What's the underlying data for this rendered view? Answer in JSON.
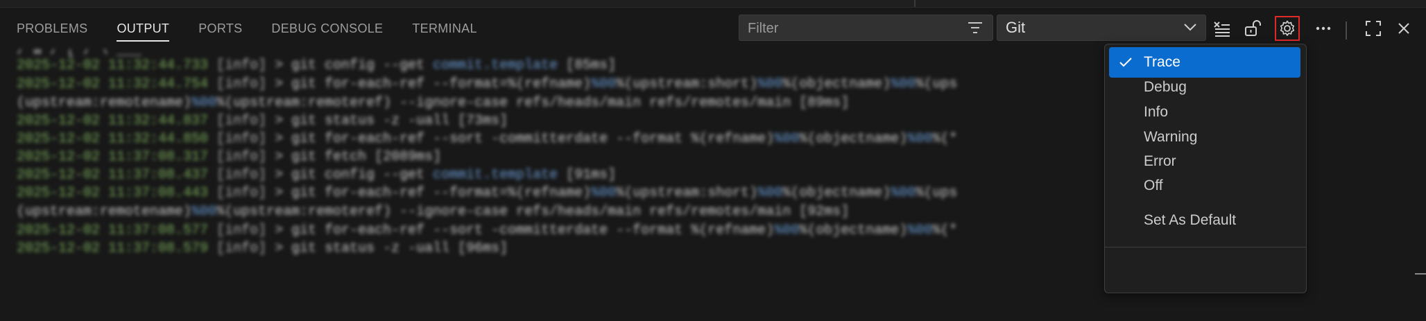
{
  "panel": {
    "tabs": [
      {
        "label": "PROBLEMS"
      },
      {
        "label": "OUTPUT"
      },
      {
        "label": "PORTS"
      },
      {
        "label": "DEBUG CONSOLE"
      },
      {
        "label": "TERMINAL"
      }
    ],
    "active_tab": "OUTPUT",
    "filter": {
      "placeholder": "Filter",
      "value": ""
    },
    "channel_select": {
      "value": "Git"
    },
    "toolbar_icons": [
      "clear-output-icon",
      "lock-scroll-icon",
      "settings-gear-icon",
      "more-actions-icon",
      "maximize-panel-icon",
      "close-panel-icon"
    ]
  },
  "output_lines": [
    {
      "ts": "",
      "level": "",
      "segments": [
        {
          "t": "/ w / [ / \\ ___ ",
          "hl": false
        }
      ]
    },
    {
      "ts": "2025-12-02 11:32:44.733",
      "level": "[info]",
      "segments": [
        {
          "t": "> git config --get ",
          "hl": false
        },
        {
          "t": "commit.template",
          "hl": true
        },
        {
          "t": " [85ms]",
          "hl": false
        }
      ]
    },
    {
      "ts": "2025-12-02 11:32:44.754",
      "level": "[info]",
      "segments": [
        {
          "t": "> git for-each-ref --format=%(refname)",
          "hl": false
        },
        {
          "t": "%00",
          "hl": true
        },
        {
          "t": "%(upstream:short)",
          "hl": false
        },
        {
          "t": "%00",
          "hl": true
        },
        {
          "t": "%(objectname)",
          "hl": false
        },
        {
          "t": "%00",
          "hl": true
        },
        {
          "t": "%(ups",
          "hl": false
        }
      ]
    },
    {
      "ts": "",
      "level": "",
      "segments": [
        {
          "t": "(upstream:remotename)",
          "hl": false
        },
        {
          "t": "%00",
          "hl": true
        },
        {
          "t": "%(upstream:remoteref) --ignore-case refs/heads/main refs/remotes/main [89ms]",
          "hl": false
        }
      ]
    },
    {
      "ts": "2025-12-02 11:32:44.837",
      "level": "[info]",
      "segments": [
        {
          "t": "> git status -z -uall [73ms]",
          "hl": false
        }
      ]
    },
    {
      "ts": "2025-12-02 11:32:44.850",
      "level": "[info]",
      "segments": [
        {
          "t": "> git for-each-ref --sort -committerdate --format %(refname)",
          "hl": false
        },
        {
          "t": "%00",
          "hl": true
        },
        {
          "t": "%(objectname)",
          "hl": false
        },
        {
          "t": "%00",
          "hl": true
        },
        {
          "t": "%(*",
          "hl": false
        }
      ]
    },
    {
      "ts": "2025-12-02 11:37:08.317",
      "level": "[info]",
      "segments": [
        {
          "t": "> git fetch [2089ms]",
          "hl": false
        }
      ]
    },
    {
      "ts": "2025-12-02 11:37:08.437",
      "level": "[info]",
      "segments": [
        {
          "t": "> git config --get ",
          "hl": false
        },
        {
          "t": "commit.template",
          "hl": true
        },
        {
          "t": " [91ms]",
          "hl": false
        }
      ]
    },
    {
      "ts": "2025-12-02 11:37:08.443",
      "level": "[info]",
      "segments": [
        {
          "t": "> git for-each-ref --format=%(refname)",
          "hl": false
        },
        {
          "t": "%00",
          "hl": true
        },
        {
          "t": "%(upstream:short)",
          "hl": false
        },
        {
          "t": "%00",
          "hl": true
        },
        {
          "t": "%(objectname)",
          "hl": false
        },
        {
          "t": "%00",
          "hl": true
        },
        {
          "t": "%(ups",
          "hl": false
        }
      ]
    },
    {
      "ts": "",
      "level": "",
      "segments": [
        {
          "t": "(upstream:remotename)",
          "hl": false
        },
        {
          "t": "%00",
          "hl": true
        },
        {
          "t": "%(upstream:remoteref) --ignore-case refs/heads/main refs/remotes/main [92ms]",
          "hl": false
        }
      ]
    },
    {
      "ts": "2025-12-02 11:37:08.577",
      "level": "[info]",
      "segments": [
        {
          "t": "> git for-each-ref --sort -committerdate --format %(refname)",
          "hl": false
        },
        {
          "t": "%00",
          "hl": true
        },
        {
          "t": "%(objectname)",
          "hl": false
        },
        {
          "t": "%00",
          "hl": true
        },
        {
          "t": "%(*",
          "hl": false
        }
      ]
    },
    {
      "ts": "2025-12-02 11:37:08.579",
      "level": "[info]",
      "segments": [
        {
          "t": "> git status -z -uall [96ms]",
          "hl": false
        }
      ]
    }
  ],
  "log_level_menu": {
    "items": [
      {
        "label": "Trace",
        "checked": true
      },
      {
        "label": "Debug",
        "checked": false
      },
      {
        "label": "Info",
        "checked": false
      },
      {
        "label": "Warning",
        "checked": false
      },
      {
        "label": "Error",
        "checked": false
      },
      {
        "label": "Off",
        "checked": false
      }
    ],
    "set_default_label": "Set As Default"
  },
  "colors": {
    "accent": "#0b6ccf",
    "highlight_border": "#e02b2b",
    "timestamp": "#7bae5b",
    "string_token": "#6a9cd6"
  }
}
